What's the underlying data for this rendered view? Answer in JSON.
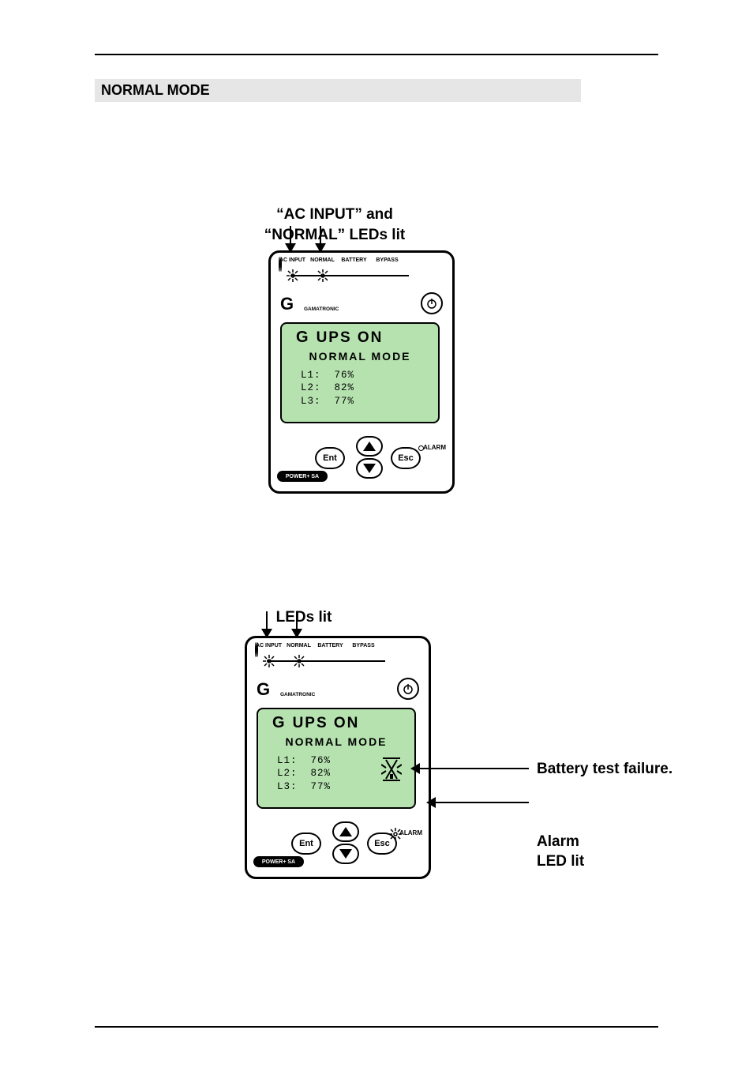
{
  "section_title": "NORMAL MODE",
  "figure1": {
    "caption": "“AC INPUT” and “NORMAL” LEDs lit",
    "leds": [
      "AC INPUT",
      "NORMAL",
      "BATTERY",
      "BYPASS"
    ],
    "brand_logo": "G",
    "brand_sub": "GAMATRONIC",
    "lcd_title": "UPS  ON",
    "lcd_mode": "NORMAL  MODE",
    "lcd_lines": "L1:  76%\nL2:  82%\nL3:  77%",
    "btn_ent": "Ent",
    "btn_esc": "Esc",
    "alarm_label": "ALARM",
    "pill_label": "POWER+ SA"
  },
  "figure2": {
    "caption": "LEDs lit",
    "leds": [
      "AC INPUT",
      "NORMAL",
      "BATTERY",
      "BYPASS"
    ],
    "brand_logo": "G",
    "brand_sub": "GAMATRONIC",
    "lcd_title": "UPS  ON",
    "lcd_mode": "NORMAL  MODE",
    "lcd_lines": "L1:  76%\nL2:  82%\nL3:  77%",
    "btn_ent": "Ent",
    "btn_esc": "Esc",
    "alarm_label": "ALARM",
    "pill_label": "POWER+ SA",
    "callout1": "Battery test failure.",
    "callout2": "Alarm\nLED lit"
  }
}
